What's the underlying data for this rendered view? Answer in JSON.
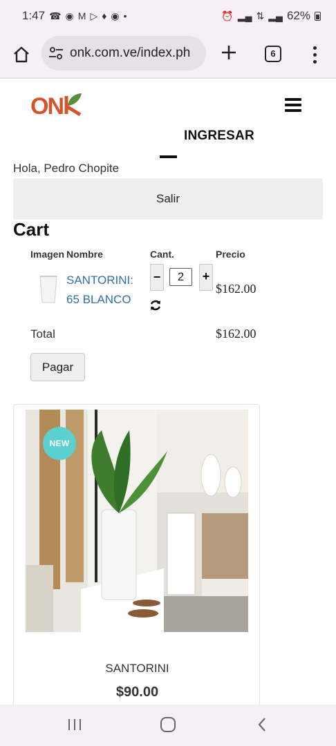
{
  "status_bar": {
    "time": "1:47",
    "battery": "62%",
    "notification_icons": [
      "whatsapp-icon",
      "messenger-icon",
      "gmail-icon",
      "play-icon",
      "tinder-icon",
      "facebook-icon",
      "dot-icon"
    ],
    "system_icons": [
      "alarm-icon",
      "signal-icon",
      "data-icon",
      "signal-icon",
      "battery-icon"
    ]
  },
  "browser": {
    "url": "onk.com.ve/index.ph",
    "tab_count": "6"
  },
  "header": {
    "logo_text": "ONK",
    "login_link": "INGRESAR"
  },
  "user": {
    "greeting": "Hola, Pedro Chopite",
    "logout_label": "Salir"
  },
  "cart": {
    "title": "Cart",
    "columns": {
      "image": "Imagen",
      "name": "Nombre",
      "qty": "Cant.",
      "price": "Precio"
    },
    "items": [
      {
        "name": "SANTORINI: 65 BLANCO",
        "qty": "2",
        "price": "$162.00"
      }
    ],
    "total_label": "Total",
    "total_value": "$162.00",
    "pay_label": "Pagar"
  },
  "product_card": {
    "badge": "NEW",
    "name": "SANTORINI",
    "price": "$90.00"
  },
  "colors": {
    "brand_orange": "#d8532b",
    "leaf_green": "#5a8f3a",
    "link_blue": "#2f6fa8",
    "badge_teal": "#5ccfcf"
  }
}
